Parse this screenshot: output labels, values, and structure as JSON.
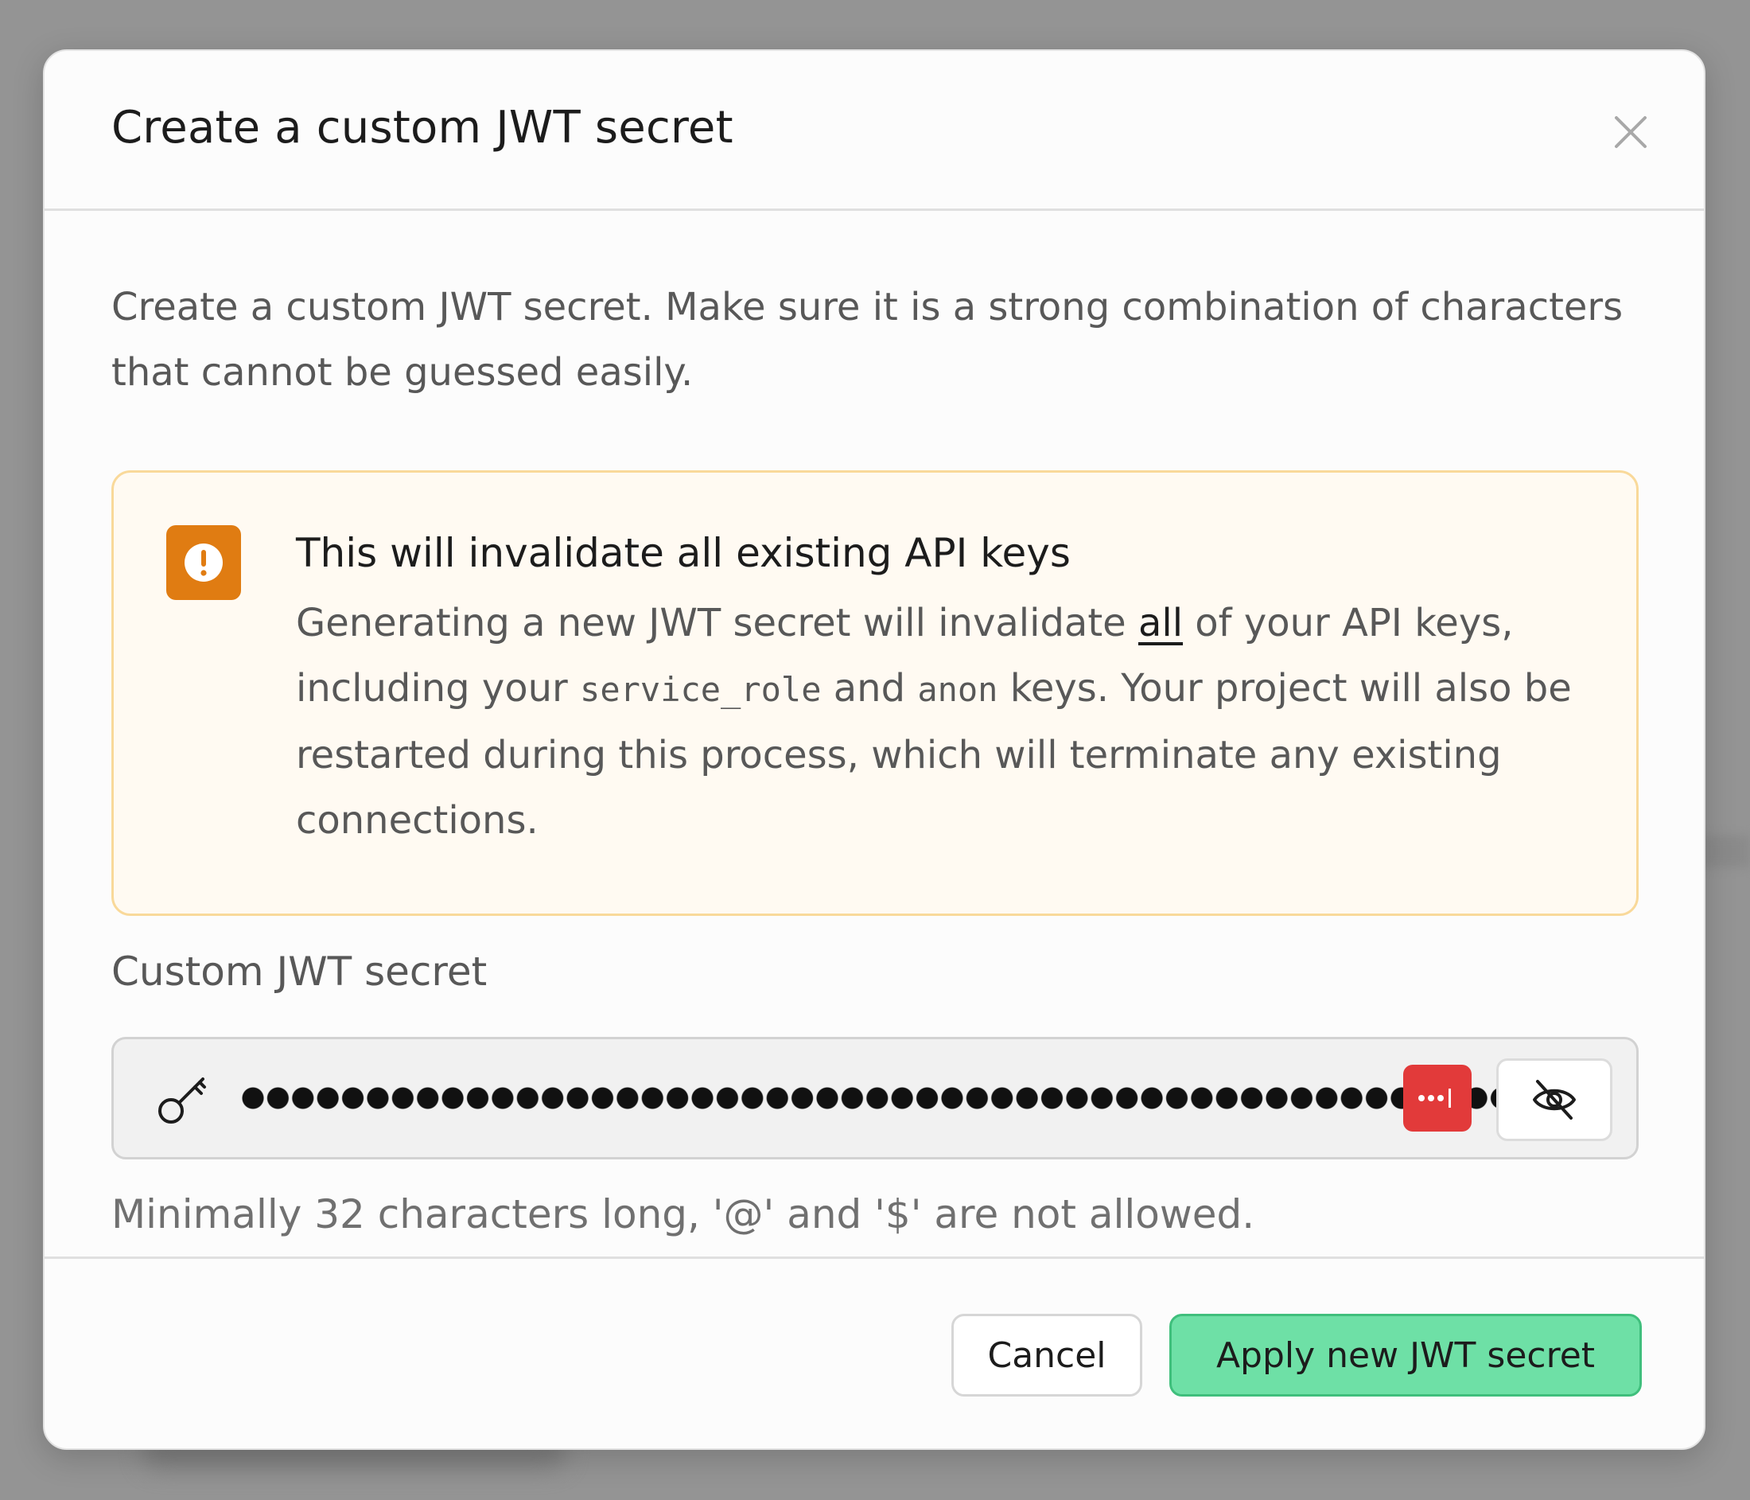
{
  "dialog": {
    "title": "Create a custom JWT secret",
    "description": "Create a custom JWT secret. Make sure it is a strong combination of characters that cannot be guessed easily."
  },
  "warning": {
    "title": "This will invalidate all existing API keys",
    "text_1": "Generating a new JWT secret will invalidate ",
    "text_emph": "all",
    "text_2": " of your API keys, including your ",
    "code_1": "service_role",
    "text_3": " and ",
    "code_2": "anon",
    "text_4": " keys. Your project will also be restarted during this process, which will terminate any existing connections.",
    "icon": "exclamation-icon",
    "accent_color": "#e07c12"
  },
  "field": {
    "label": "Custom JWT secret",
    "value_masked": "••••••••••••••••••••••••••••••••••••••••••••••••••••••",
    "hint": "Minimally 32 characters long, '@' and '$' are not allowed."
  },
  "footer": {
    "cancel_label": "Cancel",
    "apply_label": "Apply new JWT secret",
    "apply_color": "#6ee0a6"
  },
  "icons": {
    "close": "close-icon",
    "key": "key-icon",
    "visibility": "eye-off-icon",
    "password_manager": "password-manager-icon"
  }
}
